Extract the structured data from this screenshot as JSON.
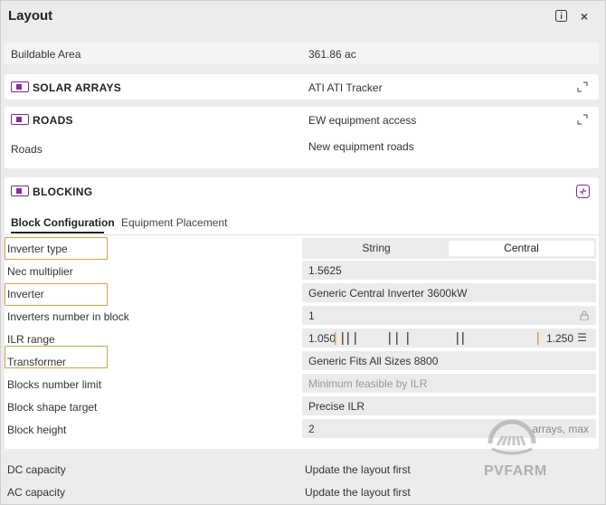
{
  "header": {
    "title": "Layout",
    "info_icon": "info-icon",
    "close_icon": "close-icon"
  },
  "buildable": {
    "label": "Buildable Area",
    "value": "361.86 ac"
  },
  "solar": {
    "title": "SOLAR ARRAYS",
    "value": "ATI ATI Tracker"
  },
  "roads": {
    "title": "ROADS",
    "value": "EW equipment access",
    "sub_label": "Roads",
    "sub_value": "New equipment roads"
  },
  "blocking": {
    "title": "BLOCKING",
    "tabs": [
      "Block Configuration",
      "Equipment Placement"
    ],
    "rows": {
      "inverter_type": {
        "label": "Inverter type",
        "options": [
          "String",
          "Central"
        ],
        "selected": "Central"
      },
      "nec": {
        "label": "Nec multiplier",
        "value": "1.5625"
      },
      "inverter": {
        "label": "Inverter",
        "value": "Generic Central Inverter 3600kW"
      },
      "inv_num": {
        "label": "Inverters number in block",
        "value": "1"
      },
      "ilr": {
        "label": "ILR range",
        "min": "1.050",
        "max": "1.250"
      },
      "transformer": {
        "label": "Transformer",
        "value": "Generic Fits All Sizes 8800"
      },
      "blocks_limit": {
        "label": "Blocks number limit",
        "placeholder": "Minimum feasible by ILR"
      },
      "shape": {
        "label": "Block shape target",
        "value": "Precise ILR"
      },
      "height": {
        "label": "Block height",
        "value": "2",
        "suffix": "arrays, max"
      }
    }
  },
  "capacity": {
    "dc": {
      "label": "DC capacity",
      "value": "Update the layout first"
    },
    "ac": {
      "label": "AC capacity",
      "value": "Update the layout first"
    }
  },
  "watermark": {
    "text": "PVFARM"
  },
  "colors": {
    "accent": "#8b2a9c",
    "highlight": "#d2a24c"
  }
}
